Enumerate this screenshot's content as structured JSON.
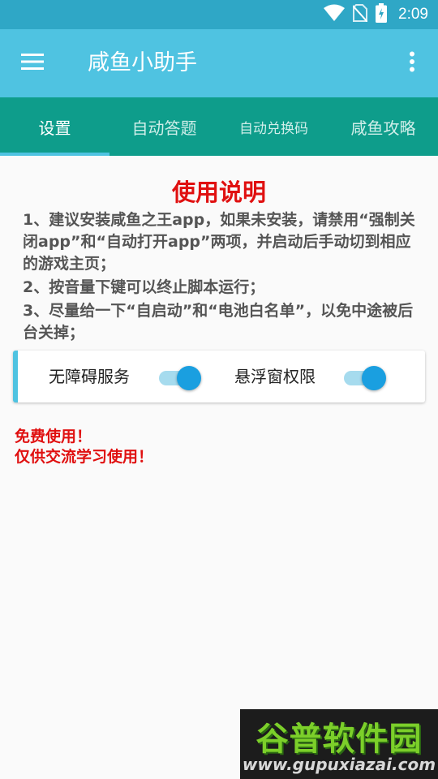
{
  "status_bar": {
    "time": "2:09",
    "icons": [
      "wifi-icon",
      "no-sim-icon",
      "battery-charging-icon"
    ]
  },
  "app_bar": {
    "title": "咸鱼小助手",
    "menu_icon": "hamburger-menu-icon",
    "more_icon": "more-vert-icon"
  },
  "tabs": [
    {
      "label": "设置",
      "active": true
    },
    {
      "label": "自动答题",
      "active": false
    },
    {
      "label": "自动兑换码",
      "active": false
    },
    {
      "label": "咸鱼攻略",
      "active": false
    }
  ],
  "main": {
    "title": "使用说明",
    "instructions": [
      "1、建议安装咸鱼之王app，如果未安装，请禁用“强制关闭app”和“自动打开app”两项，并启动后手动切到相应的游戏主页；",
      "2、按音量下键可以终止脚本运行；",
      "3、尽量给一下“自启动”和“电池白名单”，以免中途被后台关掉；"
    ],
    "permissions": [
      {
        "label": "无障碍服务",
        "enabled": true
      },
      {
        "label": "悬浮窗权限",
        "enabled": true
      }
    ],
    "notes": [
      "免费使用！",
      "仅供交流学习使用！"
    ]
  },
  "watermark": {
    "text": "谷普软件园",
    "url": "www.gupuxiazai.com"
  },
  "colors": {
    "status_bar": "#2fa7c6",
    "app_bar": "#4fc3e1",
    "tab_bar": "#0e9d8b",
    "title_red": "#e01010",
    "switch_on": "#1a9fe0"
  }
}
